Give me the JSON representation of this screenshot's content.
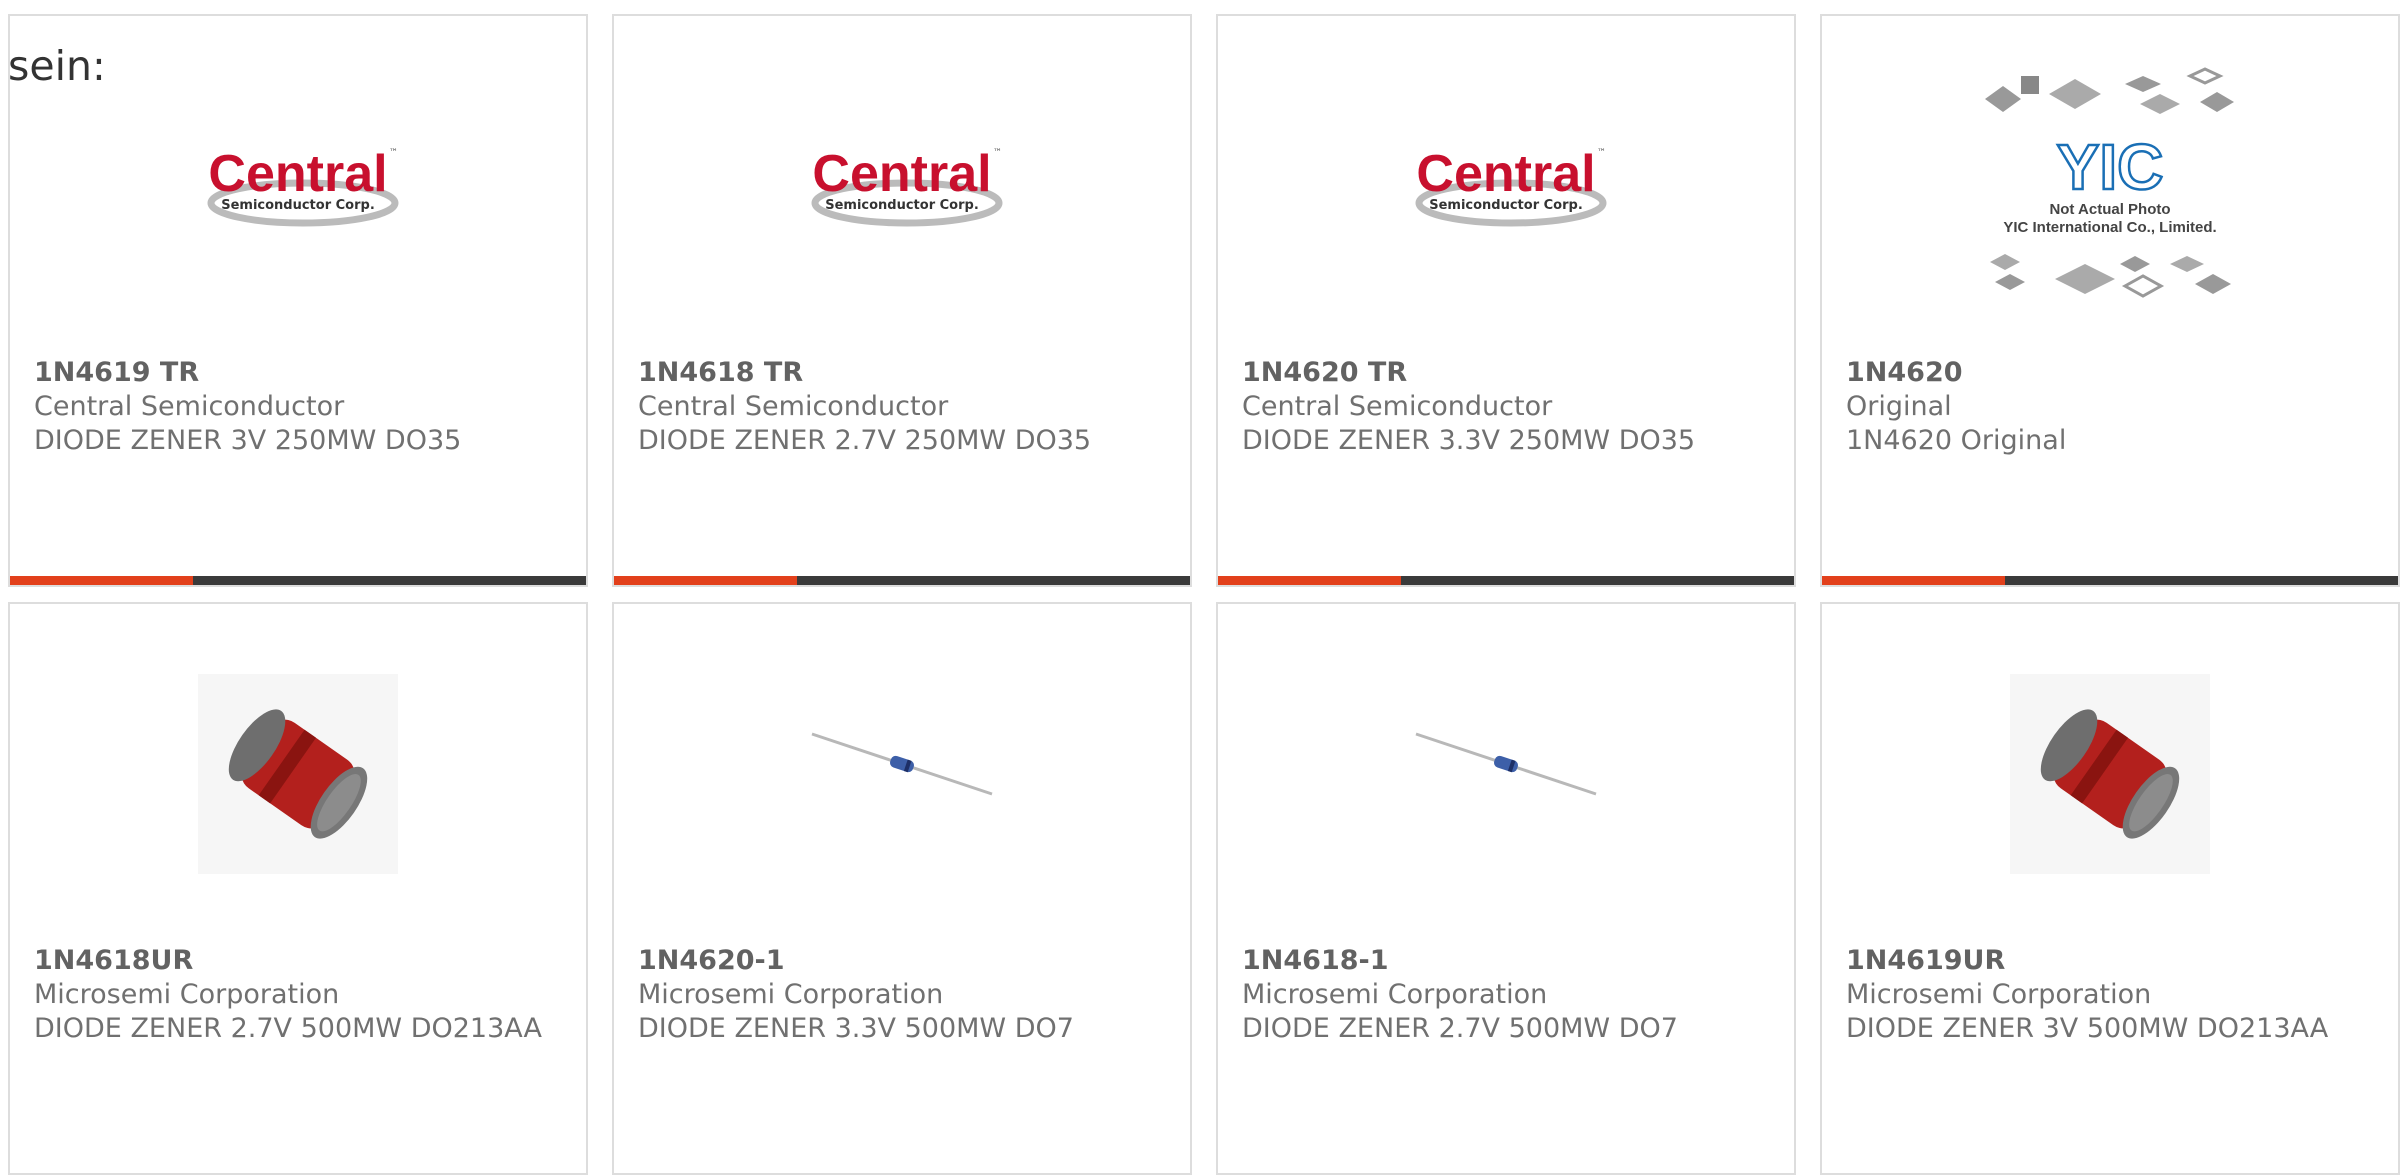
{
  "heading": "sein:",
  "colors": {
    "accent": "#e2401b",
    "bar": "#3a3a3a",
    "border": "#dddddd",
    "text": "#707070",
    "logo_red": "#c8102e"
  },
  "products": [
    {
      "part": "1N4619 TR",
      "maker": "Central Semiconductor",
      "desc": "DIODE ZENER 3V 250MW DO35",
      "image": "central-logo"
    },
    {
      "part": "1N4618 TR",
      "maker": "Central Semiconductor",
      "desc": "DIODE ZENER 2.7V 250MW DO35",
      "image": "central-logo"
    },
    {
      "part": "1N4620 TR",
      "maker": "Central Semiconductor",
      "desc": "DIODE ZENER 3.3V 250MW DO35",
      "image": "central-logo"
    },
    {
      "part": "1N4620",
      "maker": "Original",
      "desc": "1N4620 Original",
      "image": "yic-placeholder"
    },
    {
      "part": "1N4618UR",
      "maker": "Microsemi Corporation",
      "desc": "DIODE ZENER 2.7V 500MW DO213AA",
      "image": "melf-diode"
    },
    {
      "part": "1N4620-1",
      "maker": "Microsemi Corporation",
      "desc": "DIODE ZENER 3.3V 500MW DO7",
      "image": "axial-diode"
    },
    {
      "part": "1N4618-1",
      "maker": "Microsemi Corporation",
      "desc": "DIODE ZENER 2.7V 500MW DO7",
      "image": "axial-diode"
    },
    {
      "part": "1N4619UR",
      "maker": "Microsemi Corporation",
      "desc": "DIODE ZENER 3V 500MW DO213AA",
      "image": "melf-diode"
    }
  ],
  "logo": {
    "brand": "Central",
    "tm": "™",
    "sub": "Semiconductor Corp."
  },
  "yic": {
    "brand": "YIC",
    "line1": "Not Actual Photo",
    "line2": "YIC International Co., Limited."
  }
}
